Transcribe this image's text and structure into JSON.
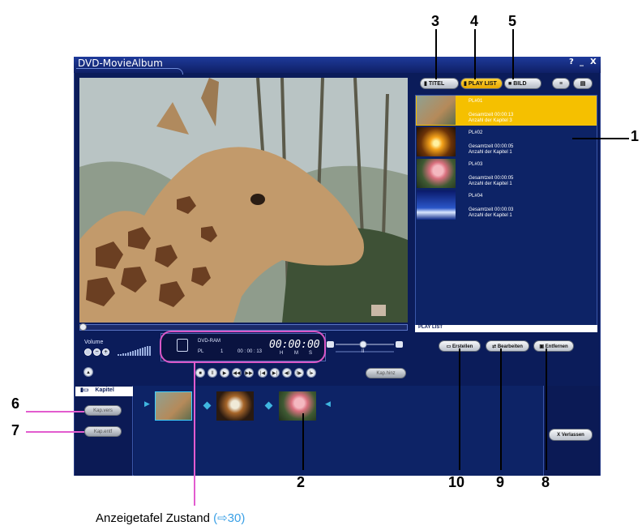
{
  "window": {
    "title": "DVD-MovieAlbum",
    "help": "?",
    "minimize": "_",
    "close": "X"
  },
  "volume": {
    "label": "Volume",
    "minus": "−",
    "plus": "+"
  },
  "status_panel": {
    "media": "DVD-RAM",
    "mode": "PL",
    "number": "1",
    "total": "00 : 00 : 13",
    "time": "00:00:00",
    "h": "H",
    "m": "M",
    "s": "S",
    "speed_value": "II"
  },
  "transport": {
    "stop": "■",
    "pause": "II",
    "play": "▶",
    "kap_hinz": "Kap.hinz"
  },
  "tabs": {
    "titel": "TITEL",
    "playlist": "PLAY LIST",
    "bild": "BILD"
  },
  "playlist": {
    "items": [
      {
        "name": "PL#01",
        "gesamt": "Gesamtzeit 00:00:13",
        "kapitel": "Anzahl der Kapitel   3",
        "selected": true
      },
      {
        "name": "PL#02",
        "gesamt": "Gesamtzeit 00:00:05",
        "kapitel": "Anzahl der Kapitel   1",
        "selected": false
      },
      {
        "name": "PL#03",
        "gesamt": "Gesamtzeit 00:00:05",
        "kapitel": "Anzahl der Kapitel   1",
        "selected": false
      },
      {
        "name": "PL#04",
        "gesamt": "Gesamtzeit 00:00:03",
        "kapitel": "Anzahl der Kapitel   1",
        "selected": false
      }
    ],
    "footer": "PLAY LIST",
    "selected_color": "#f5c000"
  },
  "actions": {
    "erstellen": "Erstellen",
    "bearbeiten": "Bearbeiten",
    "entfernen": "Entfernen"
  },
  "chapter": {
    "header": "Kapitel",
    "kap_vers": "Kap.vers",
    "kap_entf": "Kap.entf"
  },
  "exit": {
    "label": "Verlassen",
    "mark": "X"
  },
  "callouts": {
    "n1": "1",
    "n2": "2",
    "n3": "3",
    "n4": "4",
    "n5": "5",
    "n6": "6",
    "n7": "7",
    "n8": "8",
    "n9": "9",
    "n10": "10"
  },
  "caption": {
    "text": "Anzeigetafel Zustand ",
    "link": "(⇨30)"
  },
  "colors": {
    "window_bg": "#0b1c5a",
    "accent_magenta": "#e25ccf",
    "link_blue": "#3aa0e6"
  }
}
